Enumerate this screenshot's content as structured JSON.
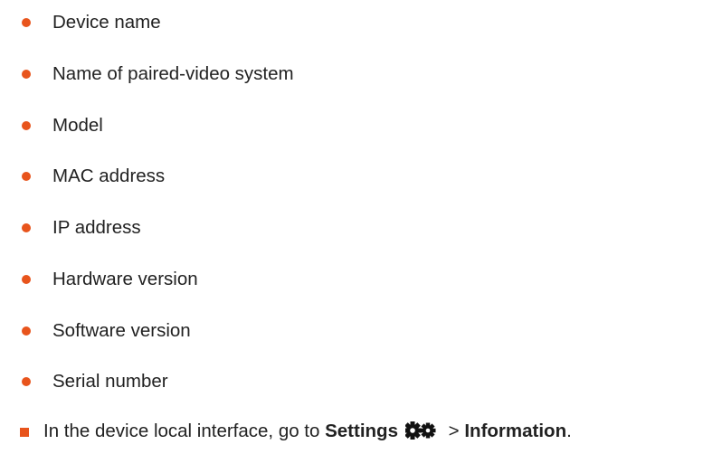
{
  "items": [
    "Device name",
    "Name of paired-video system",
    "Model",
    "MAC address",
    "IP address",
    "Hardware version",
    "Software version",
    "Serial number"
  ],
  "instruction": {
    "prefix": "In the device local interface, go to ",
    "settings_label": "Settings",
    "icon": "gear-icon",
    "separator": " > ",
    "information_label": "Information",
    "suffix": "."
  },
  "colors": {
    "accent": "#e8541c",
    "text": "#222222"
  }
}
